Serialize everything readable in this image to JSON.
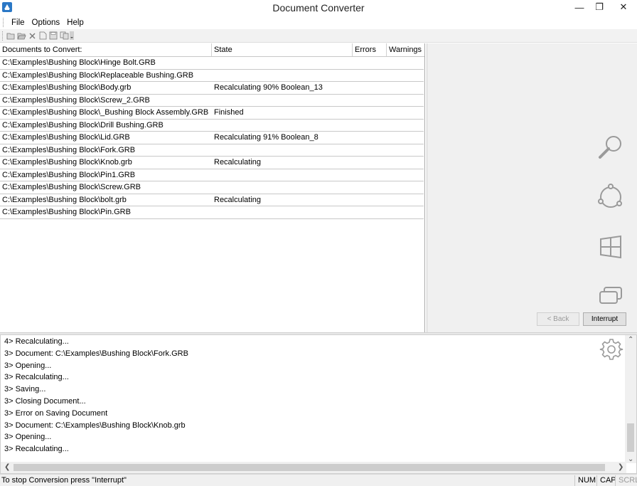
{
  "window": {
    "title": "Document Converter",
    "minimize": "—",
    "maximize": "❐",
    "close": "✕"
  },
  "menu": {
    "items": [
      "File",
      "Options",
      "Help"
    ]
  },
  "toolbar": {
    "icons": [
      "open-icon",
      "open-folder-icon",
      "delete-icon",
      "document-icon",
      "save-icon",
      "copy-icon"
    ]
  },
  "grid": {
    "columns": [
      "Documents to Convert:",
      "State",
      "Errors",
      "Warnings"
    ],
    "rows": [
      {
        "document": "C:\\Examples\\Bushing Block\\Hinge Bolt.GRB",
        "state": "",
        "errors": "",
        "warnings": ""
      },
      {
        "document": "C:\\Examples\\Bushing Block\\Replaceable Bushing.GRB",
        "state": "",
        "errors": "",
        "warnings": ""
      },
      {
        "document": "C:\\Examples\\Bushing Block\\Body.grb",
        "state": "Recalculating 90% Boolean_13",
        "errors": "",
        "warnings": ""
      },
      {
        "document": "C:\\Examples\\Bushing Block\\Screw_2.GRB",
        "state": "",
        "errors": "",
        "warnings": ""
      },
      {
        "document": "C:\\Examples\\Bushing Block\\_Bushing Block Assembly.GRB",
        "state": "Finished",
        "errors": "",
        "warnings": ""
      },
      {
        "document": "C:\\Examples\\Bushing Block\\Drill Bushing.GRB",
        "state": "",
        "errors": "",
        "warnings": ""
      },
      {
        "document": "C:\\Examples\\Bushing Block\\Lid.GRB",
        "state": "Recalculating 91% Boolean_8",
        "errors": "",
        "warnings": ""
      },
      {
        "document": "C:\\Examples\\Bushing Block\\Fork.GRB",
        "state": "",
        "errors": "",
        "warnings": ""
      },
      {
        "document": "C:\\Examples\\Bushing Block\\Knob.grb",
        "state": "Recalculating",
        "errors": "",
        "warnings": ""
      },
      {
        "document": "C:\\Examples\\Bushing Block\\Pin1.GRB",
        "state": "",
        "errors": "",
        "warnings": ""
      },
      {
        "document": "C:\\Examples\\Bushing Block\\Screw.GRB",
        "state": "",
        "errors": "",
        "warnings": ""
      },
      {
        "document": "C:\\Examples\\Bushing Block\\bolt.grb",
        "state": "Recalculating",
        "errors": "",
        "warnings": ""
      },
      {
        "document": "C:\\Examples\\Bushing Block\\Pin.GRB",
        "state": "",
        "errors": "",
        "warnings": ""
      }
    ]
  },
  "side_panel": {
    "icons": [
      "search-icon",
      "globe-icon",
      "windows-icon",
      "dual-screen-icon"
    ],
    "back_label": "< Back",
    "interrupt_label": "Interrupt"
  },
  "log": {
    "lines": [
      "4> Recalculating...",
      "3> Document: C:\\Examples\\Bushing Block\\Fork.GRB",
      "3> Opening...",
      "3> Recalculating...",
      "3> Saving...",
      "3> Closing Document...",
      "3> Error on Saving Document",
      "3> Document: C:\\Examples\\Bushing Block\\Knob.grb",
      "3> Opening...",
      "3> Recalculating..."
    ]
  },
  "status": {
    "text": "To stop Conversion press \"Interrupt\"",
    "num": "NUM",
    "cap": "CAP",
    "scrl": "SCRL"
  }
}
